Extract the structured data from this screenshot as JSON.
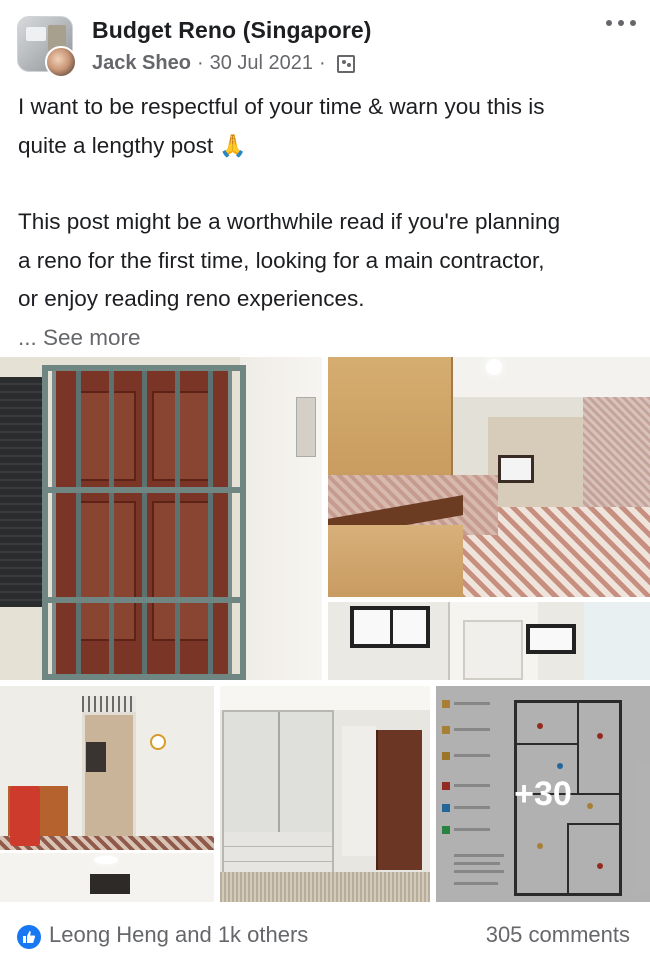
{
  "post": {
    "group_name": "Budget Reno (Singapore)",
    "author": "Jack Sheo",
    "separator": "·",
    "date": "30 Jul 2021",
    "privacy_icon": "group-members-icon",
    "more_icon": "more-options-icon"
  },
  "body": {
    "line1": "I want to be respectful of your time & warn you this is",
    "line2": "quite a lengthy post",
    "emoji": "🙏",
    "para2_line1": "This post might be a worthwhile read if you're planning",
    "para2_line2": "a reno for the first time, looking for a main contractor,",
    "para2_line3": "or enjoy reading reno experiences.",
    "see_more": "... See more"
  },
  "photos": {
    "count": 6,
    "more_overlay": "+30"
  },
  "reactions": {
    "icon": "like-icon",
    "accent": "#1877f2",
    "summary": "Leong Heng and 1k others",
    "comments": "305 comments"
  }
}
